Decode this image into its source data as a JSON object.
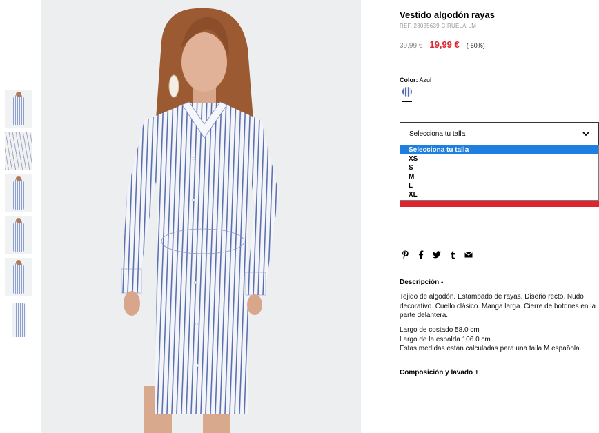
{
  "product": {
    "title": "Vestido algodón rayas",
    "ref": "REF. 23035639-CIRUELA-LM",
    "old_price": "39,99 €",
    "new_price": "19,99 €",
    "discount": "(-50%)"
  },
  "color": {
    "label": "Color:",
    "value": "Azul",
    "swatch_icon": "striped-swatch"
  },
  "size": {
    "select_label": "Selecciona tu talla",
    "options": [
      "Selecciona tu talla",
      "XS",
      "S",
      "M",
      "L",
      "XL"
    ],
    "selected_index": 0
  },
  "share_icons": [
    "pinterest-icon",
    "facebook-icon",
    "twitter-icon",
    "tumblr-icon",
    "mail-icon"
  ],
  "description": {
    "title": "Descripción -",
    "body": "Tejido de algodón. Estampado de rayas. Diseño recto. Nudo decorativo. Cuello clásico. Manga larga. Cierre de botones en la parte delantera.",
    "measures": [
      "Largo de costado 58.0 cm",
      "Largo de la espalda 106.0 cm",
      "Estas medidas están calculadas para una talla M española."
    ]
  },
  "composition": {
    "title": "Composición y lavado +"
  },
  "colors": {
    "accent_red": "#e0242e",
    "select_blue": "#1e7fe0",
    "stripe_blue": "#4e6db4"
  }
}
